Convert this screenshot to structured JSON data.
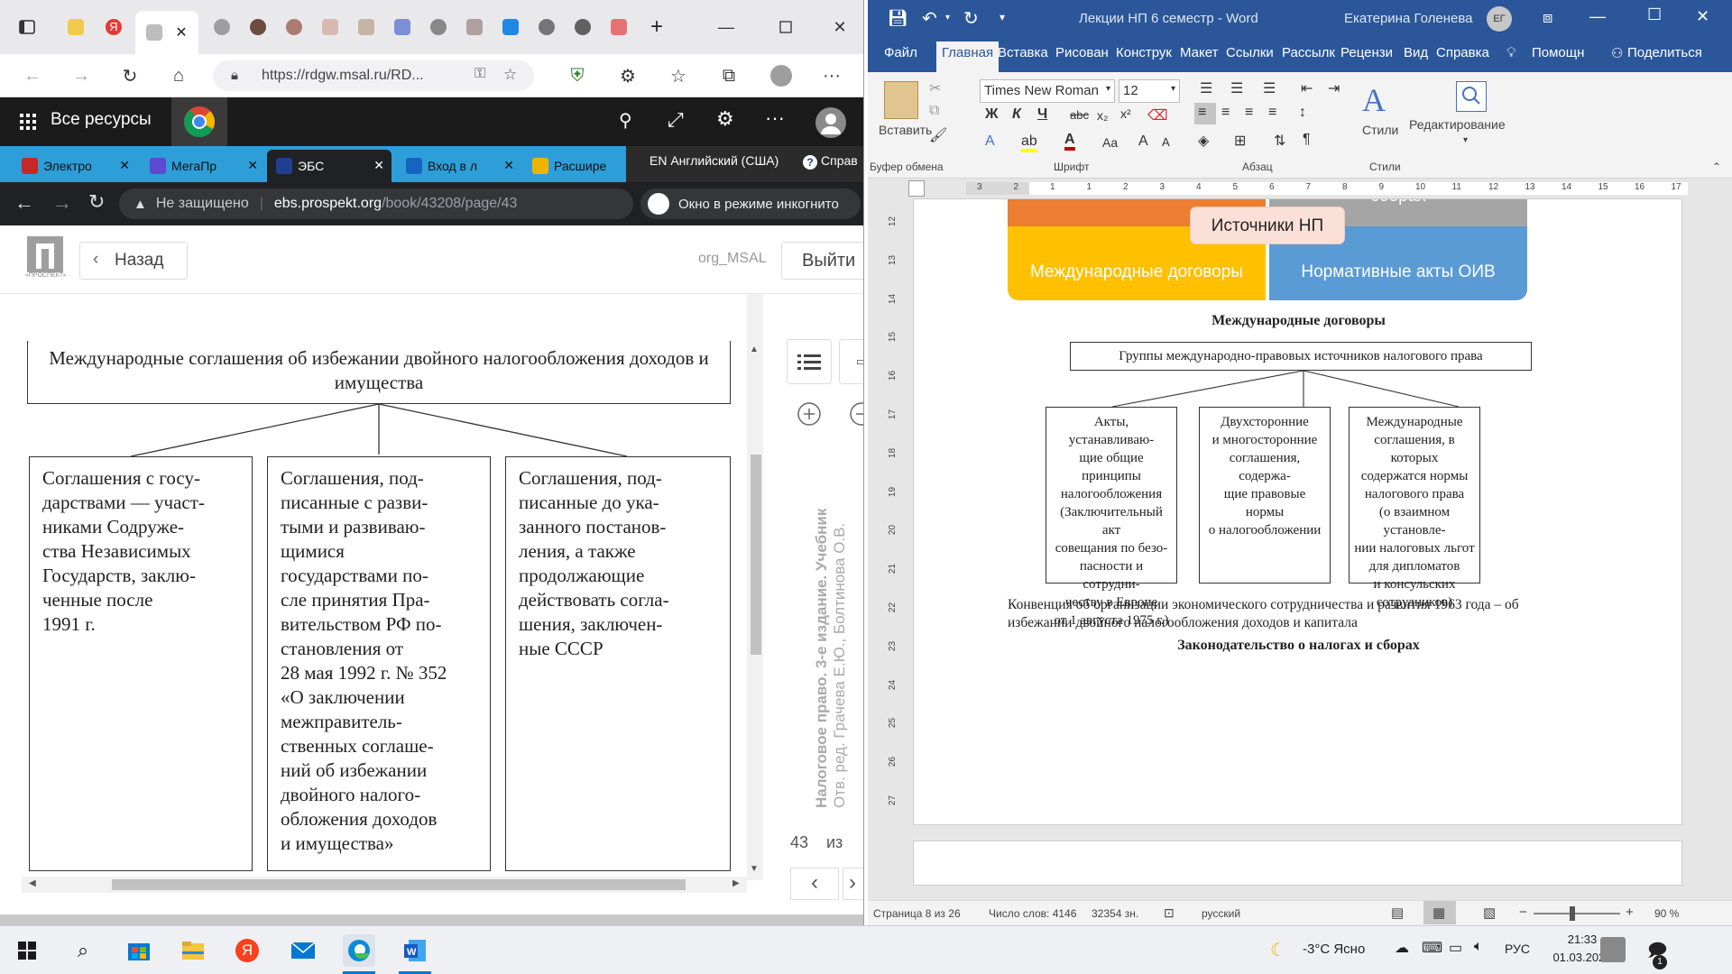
{
  "edge": {
    "address": "https://rdgw.msal.ru/RD...",
    "bookmarks_title": "Все ресурсы"
  },
  "chrome": {
    "tabs": [
      {
        "label": "Электро",
        "color": "#c62828"
      },
      {
        "label": "МегаПр",
        "color": "#5c4bd1"
      },
      {
        "label": "ЭБС",
        "color": "#1f3f8f"
      },
      {
        "label": "Вход в л",
        "color": "#1565c0"
      },
      {
        "label": "Расшире",
        "color": "#f0b400"
      }
    ],
    "lang_bar": "EN Английский (США)",
    "help_label": "Справ",
    "security": "Не защищено",
    "url_host": "ebs.prospekt.org",
    "url_path": "/book/43208/page/43",
    "incognito": "Окно в режиме инкогнито"
  },
  "ebs": {
    "logo_caption": "«ПРОСПЕКТ»",
    "back": "Назад",
    "org": "org_MSAL",
    "exit": "Выйти"
  },
  "book": {
    "top_box": "Международные соглашения об избежании двойного налогообложения доходов и имущества",
    "boxes": [
      "Соглашения с госу-\nдарствами — участ-\nниками Содруже-\nства Независимых\nГосударств, заклю-\nченные после\n1991 г.",
      "Соглашения, под-\nписанные с разви-\nтыми и развиваю-\nщимися\nгосударствами по-\nсле принятия Пра-\nвительством РФ по-\nстановления от\n28 мая 1992 г. № 352\n«О заключении\nмежправитель-\nственных соглаше-\nний об избежании\nдвойного налого-\nобложения доходов\nи имущества»",
      "Соглашения, под-\nписанные до ука-\nзанного постанов-\nления, а также\nпродолжающие\nдействовать согла-\nшения, заключен-\nные СССР"
    ],
    "side_title": "Налоговое право. 3-е издание. Учебник",
    "side_authors": "Отв. ред. Грачева Е.Ю., Болтинова О.В.",
    "page_num": "43",
    "page_of": "из"
  },
  "word": {
    "title": "Лекции НП 6 семестр - Word",
    "user": "Екатерина Голенева",
    "user_initials": "ЕГ",
    "tabs": [
      "Файл",
      "Главная",
      "Вставка",
      "Рисован",
      "Конструк",
      "Макет",
      "Ссылки",
      "Рассылк",
      "Рецензи",
      "Вид",
      "Справка"
    ],
    "tell_me": "Помощн",
    "share": "Поделиться",
    "paste": "Вставить",
    "font_name": "Times New Roman",
    "font_size": "12",
    "bold": "Ж",
    "italic": "К",
    "underline": "Ч",
    "styles": "Стили",
    "editing": "Редактирование",
    "groups": [
      "Буфер обмена",
      "Шрифт",
      "Абзац",
      "Стили"
    ],
    "ruler_numbers": [
      "3",
      "2",
      "1",
      "1",
      "2",
      "3",
      "4",
      "5",
      "6",
      "7",
      "8",
      "9",
      "10",
      "11",
      "12",
      "13",
      "14",
      "15",
      "16",
      "17"
    ],
    "vruler_numbers": [
      "12",
      "13",
      "14",
      "15",
      "16",
      "17",
      "18",
      "19",
      "20",
      "21",
      "22",
      "23",
      "24",
      "25",
      "26",
      "27"
    ],
    "sources": {
      "center": "Источники НП",
      "top_right": "сборах",
      "bottom_left": "Международные договоры",
      "bottom_right": "Нормативные акты ОИВ"
    },
    "heading1": "Международные договоры",
    "diagram_top": "Группы международно-правовых источников налогового права",
    "diagram_boxes": [
      "Акты, устанавливаю-\nщие общие принципы\nналогообложения\n(Заключительный акт\nсовещания по безо-\nпасности и сотрудни-\nчеству в Европе\nот 1 августа 1975 г.)",
      "Двухсторонние\nи многосторонние\nсоглашения, содержа-\nщие правовые нормы\nо налогообложении",
      "Международные\nсоглашения, в которых\nсодержатся нормы\nналогового права\n(о взаимном установле-\nнии налоговых льгот\nдля дипломатов\nи консульских\nсотрудников)"
    ],
    "para": "Конвенция об организации экономического сотрудничества и развития 1963 года – об избежании двойного налогообложения доходов и капитала",
    "heading2": "Законодательство о налогах и сборах",
    "status": {
      "page": "Страница 8 из 26",
      "words": "Число слов: 4146",
      "chars": "32354 зн.",
      "lang": "русский",
      "zoom": "90 %"
    },
    "colors": {
      "orange": "#ed7d31",
      "gray": "#a5a5a5",
      "gold": "#ffc000",
      "blue": "#5b9bd5",
      "center": "#fbe0d8"
    }
  },
  "taskbar": {
    "weather": "-3°C  Ясно",
    "lang": "РУС",
    "time": "21:33",
    "date": "01.03.2022",
    "notif": "1"
  }
}
